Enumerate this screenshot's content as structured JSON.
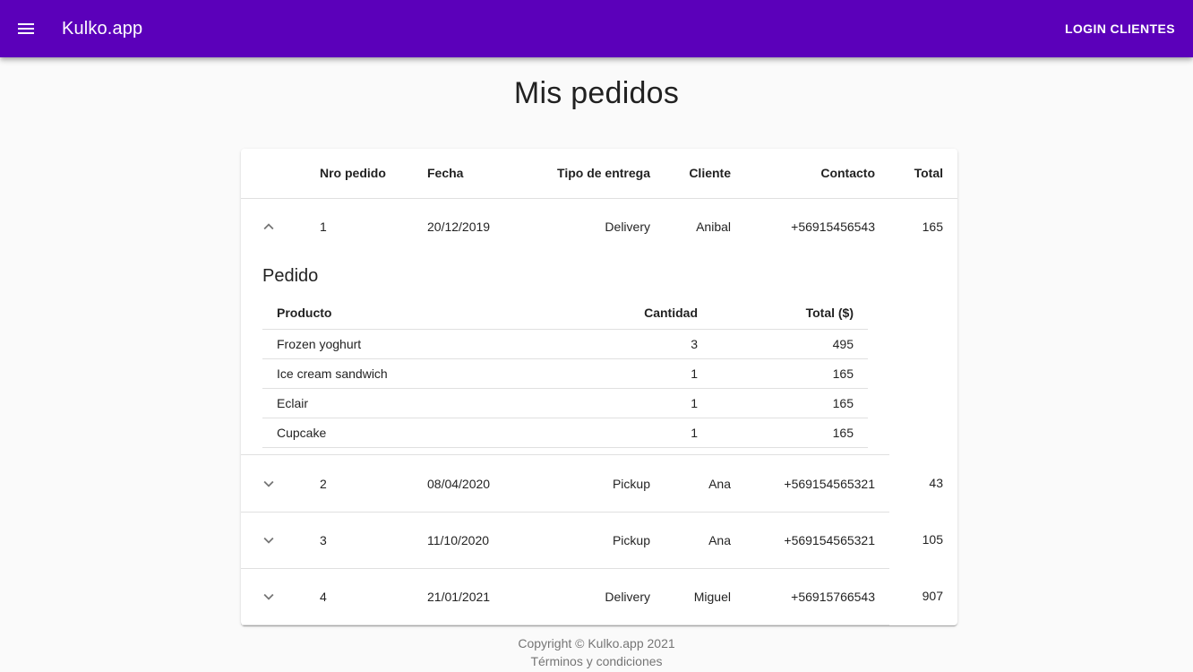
{
  "appbar": {
    "brand": "Kulko.app",
    "login_label": "LOGIN CLIENTES",
    "menu_icon": "menu-icon",
    "color": "#5b00ba"
  },
  "page": {
    "title": "Mis pedidos"
  },
  "orders_table": {
    "headers": {
      "nro": "Nro pedido",
      "fecha": "Fecha",
      "tipo": "Tipo de entrega",
      "cliente": "Cliente",
      "contacto": "Contacto",
      "total": "Total"
    },
    "rows": [
      {
        "nro": "1",
        "fecha": "20/12/2019",
        "tipo": "Delivery",
        "cliente": "Anibal",
        "contacto": "+56915456543",
        "total": "165",
        "expanded": true
      },
      {
        "nro": "2",
        "fecha": "08/04/2020",
        "tipo": "Pickup",
        "cliente": "Ana",
        "contacto": "+569154565321",
        "total": "43",
        "expanded": false
      },
      {
        "nro": "3",
        "fecha": "11/10/2020",
        "tipo": "Pickup",
        "cliente": "Ana",
        "contacto": "+569154565321",
        "total": "105",
        "expanded": false
      },
      {
        "nro": "4",
        "fecha": "21/01/2021",
        "tipo": "Delivery",
        "cliente": "Miguel",
        "contacto": "+56915766543",
        "total": "907",
        "expanded": false
      }
    ]
  },
  "detail": {
    "title": "Pedido",
    "headers": {
      "producto": "Producto",
      "cantidad": "Cantidad",
      "total": "Total ($)"
    },
    "items": [
      {
        "producto": "Frozen yoghurt",
        "cantidad": "3",
        "total": "495"
      },
      {
        "producto": "Ice cream sandwich",
        "cantidad": "1",
        "total": "165"
      },
      {
        "producto": "Eclair",
        "cantidad": "1",
        "total": "165"
      },
      {
        "producto": "Cupcake",
        "cantidad": "1",
        "total": "165"
      }
    ]
  },
  "footer": {
    "copyright": "Copyright © Kulko.app 2021",
    "terms": "Términos y condiciones"
  }
}
